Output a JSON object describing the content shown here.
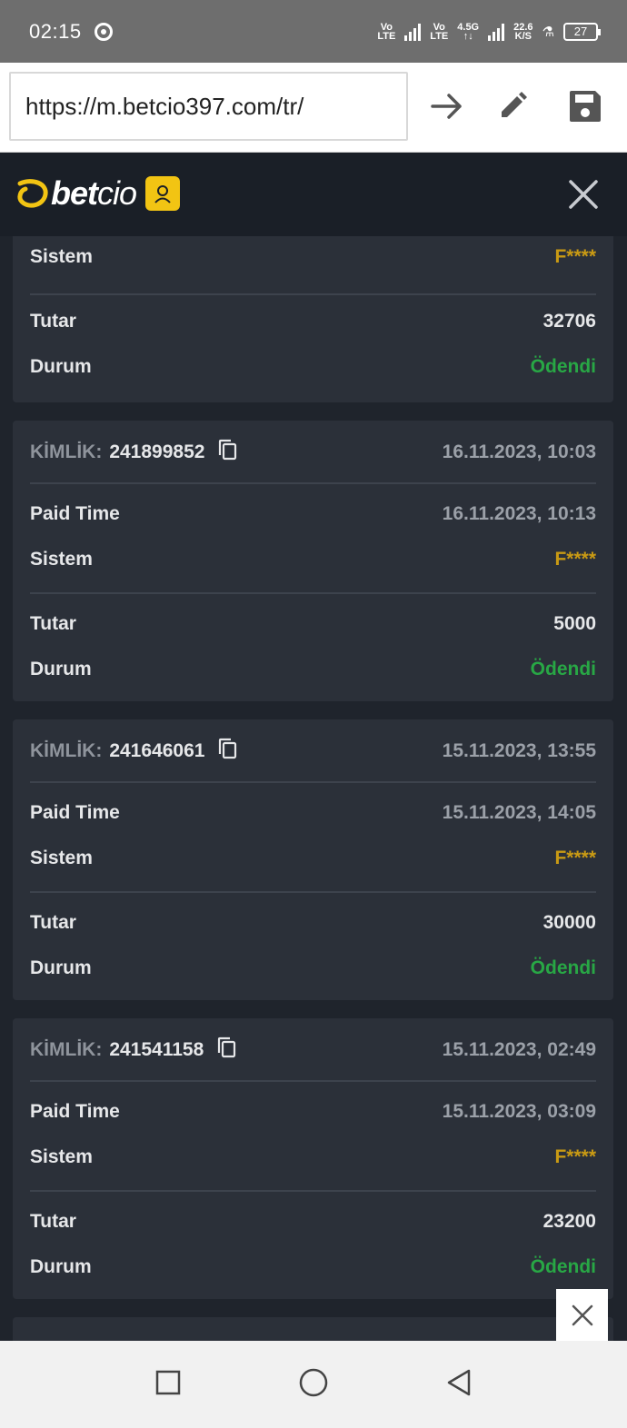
{
  "status_bar": {
    "time": "02:15",
    "net1": [
      "Vo",
      "LTE"
    ],
    "net2": [
      "Vo",
      "LTE"
    ],
    "net3": [
      "4.5G",
      "↑↓"
    ],
    "speed": [
      "22.6",
      "K/S"
    ],
    "battery": "27"
  },
  "browser": {
    "url": "https://m.betcio397.com/tr/",
    "icons": [
      "arrow-forward-icon",
      "edit-icon",
      "save-icon"
    ]
  },
  "header": {
    "logo_bold": "bet",
    "logo_light": "cio",
    "accent": "#f2c413"
  },
  "labels": {
    "kimlik": "KİMLİK:",
    "paid_time": "Paid Time",
    "sistem": "Sistem",
    "tutar": "Tutar",
    "durum": "Durum"
  },
  "partial_top": {
    "sistem": "F****",
    "tutar": "32706",
    "durum": "Ödendi"
  },
  "transactions": [
    {
      "id": "241899852",
      "created": "16.11.2023, 10:03",
      "paid_time": "16.11.2023, 10:13",
      "sistem": "F****",
      "tutar": "5000",
      "durum": "Ödendi"
    },
    {
      "id": "241646061",
      "created": "15.11.2023, 13:55",
      "paid_time": "15.11.2023, 14:05",
      "sistem": "F****",
      "tutar": "30000",
      "durum": "Ödendi"
    },
    {
      "id": "241541158",
      "created": "15.11.2023, 02:49",
      "paid_time": "15.11.2023, 03:09",
      "sistem": "F****",
      "tutar": "23200",
      "durum": "Ödendi"
    }
  ],
  "colors": {
    "gold": "#c99a14",
    "green": "#28a745",
    "card": "#2b3039",
    "background": "#1f242c"
  }
}
